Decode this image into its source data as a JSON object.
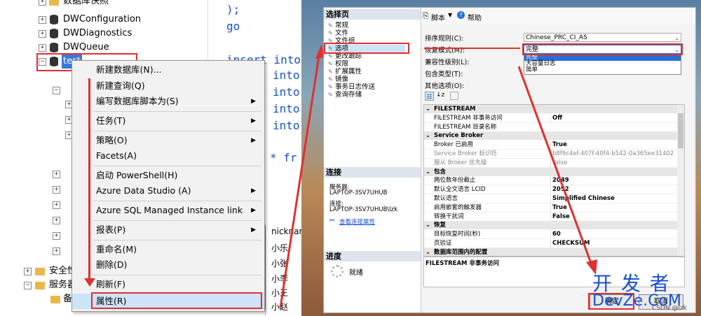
{
  "left": {
    "tree_top_partial": "数据库快照",
    "tree_items": [
      "DWConfiguration",
      "DWDiagnostics",
      "DWQueue",
      "test"
    ],
    "tree_bottom": [
      "安全性",
      "服务器"
    ],
    "tree_bottom_sub": "备",
    "code_lines": [
      ");",
      "go",
      "insert into",
      "into",
      "into",
      "into",
      "into",
      "* fr"
    ],
    "grid_header": "nicknam",
    "grid_values": [
      "小乐",
      "小张",
      "小李",
      "小王",
      "小赵"
    ],
    "context_menu": [
      {
        "label": "新建数据库(N)...",
        "submenu": false
      },
      {
        "label": "新建查询(Q)",
        "submenu": false
      },
      {
        "label": "编写数据库脚本为(S)",
        "submenu": true
      },
      {
        "label": "任务(T)",
        "submenu": true
      },
      {
        "label": "策略(O)",
        "submenu": true
      },
      {
        "label": "Facets(A)",
        "submenu": false
      },
      {
        "label": "启动 PowerShell(H)",
        "submenu": false
      },
      {
        "label": "Azure Data Studio (A)",
        "submenu": true
      },
      {
        "label": "Azure SQL Managed Instance link",
        "submenu": true
      },
      {
        "label": "报表(P)",
        "submenu": true
      },
      {
        "label": "重命名(M)",
        "submenu": false
      },
      {
        "label": "删除(D)",
        "submenu": false
      },
      {
        "label": "刷新(F)",
        "submenu": false
      },
      {
        "label": "属性(R)",
        "submenu": false
      }
    ],
    "submenu_arrow": "▶"
  },
  "dialog": {
    "pages_header": "选择页",
    "pages": [
      "常规",
      "文件",
      "文件组",
      "选项",
      "更改跟踪",
      "权限",
      "扩展属性",
      "镜像",
      "事务日志传送",
      "查询存储"
    ],
    "toolbar_script": "脚本",
    "toolbar_help": "帮助",
    "connection_header": "连接",
    "server_label": "服务器:",
    "server_value": "LAPTOP-3SV7UHUB",
    "connect_label": "连接:",
    "connect_value": "LAPTOP-3SV7UHUB\\lzk",
    "view_connection": "查看连接属性",
    "progress_header": "进度",
    "progress_status": "就绪",
    "collation_label": "排序规则(C):",
    "collation_value": "Chinese_PRC_CI_AS",
    "recovery_label": "恢复模式(M):",
    "recovery_value": "完整",
    "recovery_options": [
      "完整",
      "大容量日志",
      "简单"
    ],
    "compat_label": "兼容性级别(L):",
    "containment_label": "包含类型(T):",
    "other_label": "其他选项(O):",
    "grid": [
      {
        "cat": "FILESTREAM",
        "rows": [
          [
            "FILESTREAM 非事务访问",
            "Off"
          ],
          [
            "FILESTREAM 目录名称",
            ""
          ]
        ]
      },
      {
        "cat": "Service Broker",
        "rows": [
          [
            "Broker 已启用",
            "True"
          ],
          [
            "Service Broker 标识符",
            "b8f9c4ef-407f-40f4-b542-0a365ee31402"
          ],
          [
            "服从 Broker 优先级",
            "False"
          ]
        ]
      },
      {
        "cat": "包含",
        "rows": [
          [
            "两位数年份截止",
            "2049"
          ],
          [
            "默认全文语言 LCID",
            "2052"
          ],
          [
            "默认语言",
            "Simplified Chinese"
          ],
          [
            "启用嵌套的触发器",
            "True"
          ],
          [
            "转换干扰词",
            "False"
          ]
        ]
      },
      {
        "cat": "恢复",
        "rows": [
          [
            "目标恢复时间(秒)",
            "60"
          ],
          [
            "页验证",
            "CHECKSUM"
          ]
        ]
      },
      {
        "cat": "数据库范围内的配置",
        "rows": []
      }
    ],
    "desc_title": "FILESTREAM 非事务访问",
    "ok_button": "确定",
    "cancel_button": "取消"
  },
  "watermark": {
    "line1": "开 发 者",
    "line2": "DevZe.CoM",
    "small": "CSDN @lzk"
  },
  "colors": {
    "accent_red": "#e03030",
    "link_blue": "#1a4fd0"
  }
}
